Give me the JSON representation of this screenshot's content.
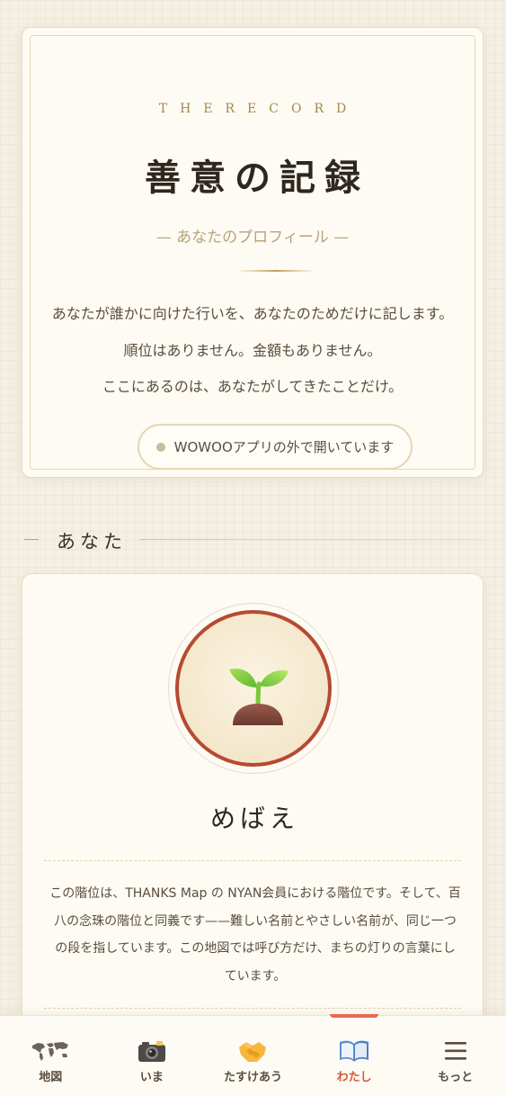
{
  "hero": {
    "eyebrow": "THERECORD",
    "title": "善意の記録",
    "subtitle": "— あなたのプロフィール —",
    "lines": [
      "あなたが誰かに向けた行いを、あなたのためだけに記します。",
      "順位はありません。金額もありません。",
      "ここにあるのは、あなたがしてきたことだけ。"
    ],
    "badge": "WOWOOアプリの外で開いています"
  },
  "section": {
    "title": "あなた"
  },
  "profile": {
    "rank_icon": "sprout-icon",
    "rank_name": "めばえ",
    "description": "この階位は、THANKS Map の NYAN会員における階位です。そして、百八の念珠の階位と同義です——難しい名前とやさしい名前が、同じ一つの段を指しています。この地図では呼び方だけ、まちの灯りの言葉にしています。",
    "ring_color": "#b64a32"
  },
  "nav": {
    "active_index": 3,
    "accent_color": "#d9573a",
    "items": [
      {
        "label": "地図",
        "icon": "world-map-icon",
        "glyph": "🗺"
      },
      {
        "label": "いま",
        "icon": "camera-icon",
        "glyph": "📷"
      },
      {
        "label": "たすけあう",
        "icon": "handshake-icon",
        "glyph": "🤝"
      },
      {
        "label": "わたし",
        "icon": "book-icon",
        "glyph": "📖"
      },
      {
        "label": "もっと",
        "icon": "menu-icon",
        "glyph": "☰"
      }
    ]
  }
}
